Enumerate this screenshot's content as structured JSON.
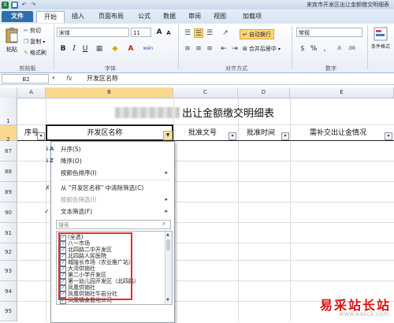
{
  "window": {
    "title": "来宾市开发区出让金额缴交明细表"
  },
  "tabs": [
    {
      "label": "文件"
    },
    {
      "label": "开始"
    },
    {
      "label": "插入"
    },
    {
      "label": "页面布局"
    },
    {
      "label": "公式"
    },
    {
      "label": "数据"
    },
    {
      "label": "审阅"
    },
    {
      "label": "视图"
    },
    {
      "label": "加载项"
    }
  ],
  "ribbon": {
    "clipboard": {
      "cut": "剪切",
      "copy": "复制",
      "format_painter": "格式刷",
      "paste": "粘贴",
      "label": "剪贴板"
    },
    "font": {
      "name": "宋体",
      "size": "11",
      "label": "字体",
      "grow": "A",
      "shrink": "A",
      "bold": "B",
      "italic": "I",
      "underline": "U",
      "wen": "wén"
    },
    "alignment": {
      "wrap": "自动换行",
      "merge": "合并后居中",
      "label": "对齐方式"
    },
    "number": {
      "format": "常规",
      "label": "数字"
    },
    "styles": {
      "conditional": "条件格式"
    }
  },
  "formula_bar": {
    "cell_ref": "B2",
    "fx": "fx",
    "content": "开发区名称"
  },
  "columns": [
    "A",
    "B",
    "C",
    "D",
    "E"
  ],
  "sheet": {
    "title": "出让金额缴交明细表",
    "title_prefix_blurred": "",
    "headers": {
      "a": "序号",
      "b": "开发区名称",
      "c": "批准文号",
      "d": "批准时间",
      "e": "需补交出让金情况"
    },
    "rows": [
      "1",
      "2",
      "87",
      "88",
      "89",
      "90",
      "91",
      "92",
      "93",
      "94",
      "95"
    ]
  },
  "menu": {
    "sort_asc": "升序(S)",
    "sort_desc": "降序(O)",
    "sort_by_color": "按颜色排序(I)",
    "clear_filter": "从 \"开发区名称\" 中清除筛选(C)",
    "filter_by_color": "按颜色筛选(I)",
    "text_filter": "文本筛选(F)",
    "search_placeholder": "搜索",
    "items": [
      {
        "label": "(全选)",
        "checked": true
      },
      {
        "label": "八一市场",
        "checked": true
      },
      {
        "label": "北四路二中开发区",
        "checked": true
      },
      {
        "label": "北四路人民医院",
        "checked": true
      },
      {
        "label": "城隍长市场（农业推广站）",
        "checked": true
      },
      {
        "label": "大湾供销社",
        "checked": true
      },
      {
        "label": "第二小学开发区",
        "checked": true
      },
      {
        "label": "第一幼儿园开发区（北四路）",
        "checked": true
      },
      {
        "label": "凤凰供销社",
        "checked": true
      },
      {
        "label": "凤凰供销社牛岩分社",
        "checked": true
      },
      {
        "label": "凤凰镇金盆地公司",
        "checked": true
      }
    ]
  },
  "watermark": {
    "text": "易采站长站",
    "url": "www.easck.com"
  },
  "colors": {
    "accent": "#2f6ea8",
    "highlight_box": "#e0312a"
  }
}
